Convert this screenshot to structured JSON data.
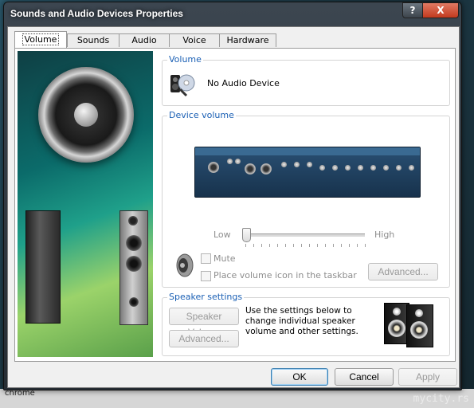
{
  "window": {
    "title": "Sounds and Audio Devices Properties",
    "help_label": "?",
    "close_label": "X"
  },
  "tabs": [
    {
      "label": "Volume",
      "active": true
    },
    {
      "label": "Sounds",
      "active": false
    },
    {
      "label": "Audio",
      "active": false
    },
    {
      "label": "Voice",
      "active": false
    },
    {
      "label": "Hardware",
      "active": false
    }
  ],
  "volume_group": {
    "label": "Volume",
    "device_name": "No Audio Device",
    "icon": "speaker-mic-icon"
  },
  "device_volume": {
    "label": "Device volume",
    "low_label": "Low",
    "high_label": "High",
    "level": 0,
    "mute_label": "Mute",
    "mute_checked": false,
    "taskbar_label": "Place volume icon in the taskbar",
    "taskbar_checked": false,
    "advanced_label": "Advanced...",
    "enabled": false
  },
  "speaker_settings": {
    "label": "Speaker settings",
    "speaker_volume_label": "Speaker Volume",
    "advanced_label": "Advanced...",
    "description": "Use the settings below to change individual speaker volume and other settings."
  },
  "footer": {
    "ok_label": "OK",
    "cancel_label": "Cancel",
    "apply_label": "Apply"
  },
  "desktop": {
    "taskbar_text": "chrome",
    "watermark": "mycity.rs"
  },
  "colors": {
    "group_label": "#1a5fb4",
    "disabled_text": "#8d8d8d",
    "close_button": "#c23a1e"
  }
}
